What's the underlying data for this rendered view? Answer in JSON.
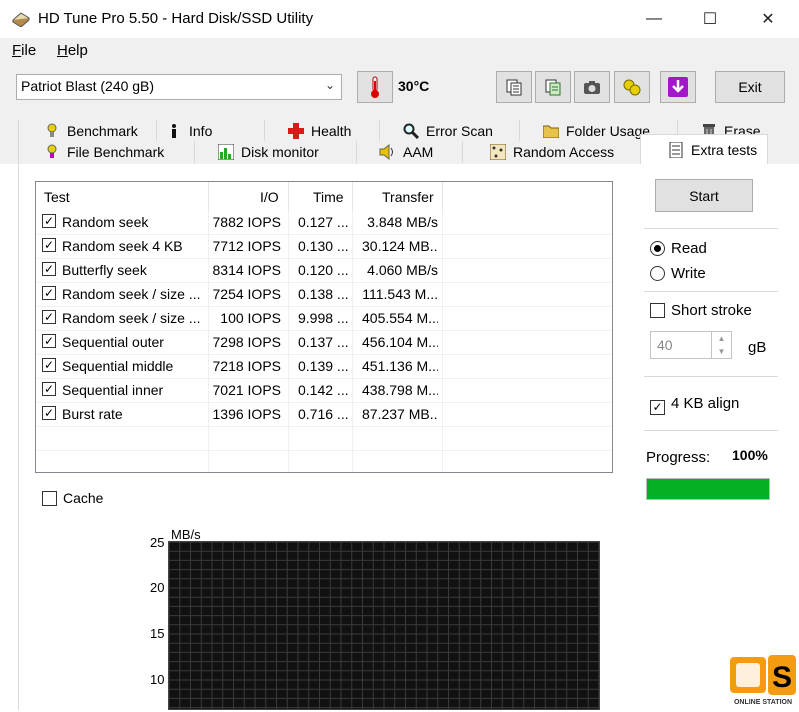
{
  "window": {
    "title": "HD Tune Pro 5.50 - Hard Disk/SSD Utility"
  },
  "window_buttons": {
    "minimize": "—",
    "maximize": "☐",
    "close": "✕"
  },
  "menu": {
    "file": {
      "accel": "F",
      "rest": "ile"
    },
    "help": {
      "accel": "H",
      "rest": "elp"
    }
  },
  "toolbar": {
    "drive": "Patriot Blast (240 gB)",
    "temperature": "30°C",
    "exit_label": "Exit",
    "icons": [
      "thermometer-icon",
      "copy-text-icon",
      "copy-info-icon",
      "screenshot-icon",
      "options-icon",
      "save-icon"
    ]
  },
  "tabs_row1": [
    {
      "label": "Benchmark",
      "icon": "benchmark-icon"
    },
    {
      "label": "Info",
      "icon": "info-icon"
    },
    {
      "label": "Health",
      "icon": "health-icon"
    },
    {
      "label": "Error Scan",
      "icon": "error-scan-icon"
    },
    {
      "label": "Folder Usage",
      "icon": "folder-icon"
    },
    {
      "label": "Erase",
      "icon": "erase-icon"
    }
  ],
  "tabs_row2": [
    {
      "label": "File Benchmark",
      "icon": "file-benchmark-icon"
    },
    {
      "label": "Disk monitor",
      "icon": "disk-monitor-icon"
    },
    {
      "label": "AAM",
      "icon": "aam-icon"
    },
    {
      "label": "Random Access",
      "icon": "random-access-icon"
    },
    {
      "label": "Extra tests",
      "icon": "extra-tests-icon",
      "active": true
    }
  ],
  "results": {
    "headers": {
      "test": "Test",
      "io": "I/O",
      "time": "Time",
      "transfer": "Transfer"
    },
    "rows": [
      {
        "test": "Random seek",
        "io": "7882 IOPS",
        "time": "0.127 ...",
        "transfer": "3.848 MB/s",
        "checked": true
      },
      {
        "test": "Random seek 4 KB",
        "io": "7712 IOPS",
        "time": "0.130 ...",
        "transfer": "30.124 MB...",
        "checked": true
      },
      {
        "test": "Butterfly seek",
        "io": "8314 IOPS",
        "time": "0.120 ...",
        "transfer": "4.060 MB/s",
        "checked": true
      },
      {
        "test": "Random seek / size ...",
        "io": "7254 IOPS",
        "time": "0.138 ...",
        "transfer": "111.543 M...",
        "checked": true
      },
      {
        "test": "Random seek / size ...",
        "io": "100 IOPS",
        "time": "9.998 ...",
        "transfer": "405.554 M...",
        "checked": true
      },
      {
        "test": "Sequential outer",
        "io": "7298 IOPS",
        "time": "0.137 ...",
        "transfer": "456.104 M...",
        "checked": true
      },
      {
        "test": "Sequential middle",
        "io": "7218 IOPS",
        "time": "0.139 ...",
        "transfer": "451.136 M...",
        "checked": true
      },
      {
        "test": "Sequential inner",
        "io": "7021 IOPS",
        "time": "0.142 ...",
        "transfer": "438.798 M...",
        "checked": true
      },
      {
        "test": "Burst rate",
        "io": "1396 IOPS",
        "time": "0.716 ...",
        "transfer": "87.237 MB...",
        "checked": true
      }
    ]
  },
  "cache_label": "Cache",
  "side": {
    "start_label": "Start",
    "read_label": "Read",
    "write_label": "Write",
    "mode": "Read",
    "short_stroke_label": "Short stroke",
    "short_stroke_value": "40",
    "gb_label": "gB",
    "align_label": "4 KB align",
    "align_checked": true,
    "progress_label": "Progress:",
    "progress_text": "100%",
    "progress_value": 1.0
  },
  "graph": {
    "unit": "MB/s",
    "ticks": [
      "25",
      "20",
      "15",
      "10"
    ]
  },
  "colors": {
    "progress": "#06b025",
    "graph_bg": "#111111",
    "graph_grid": "#3a3a3a"
  },
  "watermark": {
    "letter": "S",
    "text": "ONLINE STATION"
  }
}
